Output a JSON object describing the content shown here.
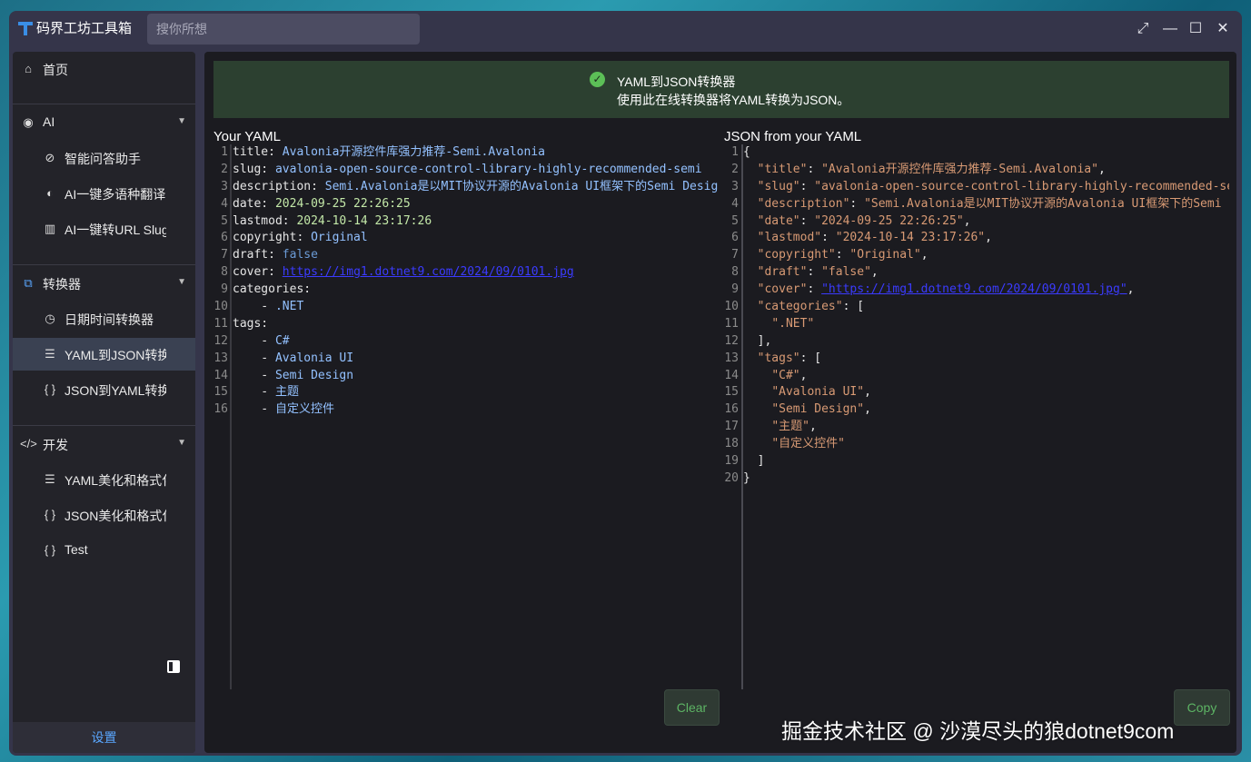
{
  "app": {
    "title": "码界工坊工具箱"
  },
  "search": {
    "placeholder": "搜你所想"
  },
  "sidebar": {
    "home": "首页",
    "group_ai": "AI",
    "ai_items": [
      "智能问答助手",
      "AI一键多语种翻译",
      "AI一键转URL Slug"
    ],
    "group_converter": "转换器",
    "converter_items": [
      "日期时间转换器",
      "YAML到JSON转换器",
      "JSON到YAML转换器"
    ],
    "group_dev": "开发",
    "dev_items": [
      "YAML美化和格式化",
      "JSON美化和格式化",
      "Test"
    ],
    "settings": "设置"
  },
  "banner": {
    "title": "YAML到JSON转换器",
    "description": "使用此在线转换器将YAML转换为JSON。"
  },
  "yaml_pane": {
    "title": "Your YAML",
    "lines": [
      {
        "k": "title: ",
        "v": "Avalonia开源控件库强力推荐-Semi.Avalonia",
        "t": "v"
      },
      {
        "k": "slug: ",
        "v": "avalonia-open-source-control-library-highly-recommended-semi",
        "t": "v"
      },
      {
        "k": "description: ",
        "v": "Semi.Avalonia是以MIT协议开源的Avalonia UI框架下的Semi Design",
        "t": "v"
      },
      {
        "k": "date: ",
        "v": "2024-09-25 22:26:25",
        "t": "num"
      },
      {
        "k": "lastmod: ",
        "v": "2024-10-14 23:17:26",
        "t": "num"
      },
      {
        "k": "copyright: ",
        "v": "Original",
        "t": "v"
      },
      {
        "k": "draft: ",
        "v": "false",
        "t": "bool"
      },
      {
        "k": "cover: ",
        "v": "https://img1.dotnet9.com/2024/09/0101.jpg",
        "t": "url"
      },
      {
        "k": "categories:",
        "v": "",
        "t": "v"
      },
      {
        "k": "    - ",
        "v": ".NET",
        "t": "v"
      },
      {
        "k": "tags:",
        "v": "",
        "t": "v"
      },
      {
        "k": "    - ",
        "v": "C#",
        "t": "v"
      },
      {
        "k": "    - ",
        "v": "Avalonia UI",
        "t": "v"
      },
      {
        "k": "    - ",
        "v": "Semi Design",
        "t": "v"
      },
      {
        "k": "    - ",
        "v": "主题",
        "t": "v"
      },
      {
        "k": "    - ",
        "v": "自定义控件",
        "t": "v"
      }
    ]
  },
  "json_pane": {
    "title": "JSON from your YAML",
    "lines": [
      {
        "p": "{",
        "k": "",
        "s": "",
        "e": ""
      },
      {
        "p": "  ",
        "k": "\"title\"",
        "s": "\"Avalonia开源控件库强力推荐-Semi.Avalonia\"",
        "e": ","
      },
      {
        "p": "  ",
        "k": "\"slug\"",
        "s": "\"avalonia-open-source-control-library-highly-recommended-semi\"",
        "e": ","
      },
      {
        "p": "  ",
        "k": "\"description\"",
        "s": "\"Semi.Avalonia是以MIT协议开源的Avalonia UI框架下的Semi Design\"",
        "e": ","
      },
      {
        "p": "  ",
        "k": "\"date\"",
        "s": "\"2024-09-25 22:26:25\"",
        "e": ","
      },
      {
        "p": "  ",
        "k": "\"lastmod\"",
        "s": "\"2024-10-14 23:17:26\"",
        "e": ","
      },
      {
        "p": "  ",
        "k": "\"copyright\"",
        "s": "\"Original\"",
        "e": ","
      },
      {
        "p": "  ",
        "k": "\"draft\"",
        "s": "\"false\"",
        "e": ","
      },
      {
        "p": "  ",
        "k": "\"cover\"",
        "s": "\"https://img1.dotnet9.com/2024/09/0101.jpg\"",
        "e": ","
      },
      {
        "p": "  ",
        "k": "\"categories\"",
        "s": "[",
        "e": ""
      },
      {
        "p": "    ",
        "k": "",
        "s": "\".NET\"",
        "e": ""
      },
      {
        "p": "  ],",
        "k": "",
        "s": "",
        "e": ""
      },
      {
        "p": "  ",
        "k": "\"tags\"",
        "s": "[",
        "e": ""
      },
      {
        "p": "    ",
        "k": "",
        "s": "\"C#\"",
        "e": ","
      },
      {
        "p": "    ",
        "k": "",
        "s": "\"Avalonia UI\"",
        "e": ","
      },
      {
        "p": "    ",
        "k": "",
        "s": "\"Semi Design\"",
        "e": ","
      },
      {
        "p": "    ",
        "k": "",
        "s": "\"主题\"",
        "e": ","
      },
      {
        "p": "    ",
        "k": "",
        "s": "\"自定义控件\"",
        "e": ""
      },
      {
        "p": "  ]",
        "k": "",
        "s": "",
        "e": ""
      },
      {
        "p": "}",
        "k": "",
        "s": "",
        "e": ""
      }
    ]
  },
  "buttons": {
    "clear": "Clear",
    "copy": "Copy"
  },
  "watermark": "掘金技术社区 @ 沙漠尽头的狼dotnet9com",
  "colors": {
    "accent": "#5aa7ff",
    "success": "#5cbf57",
    "banner_bg": "#2c4030"
  }
}
